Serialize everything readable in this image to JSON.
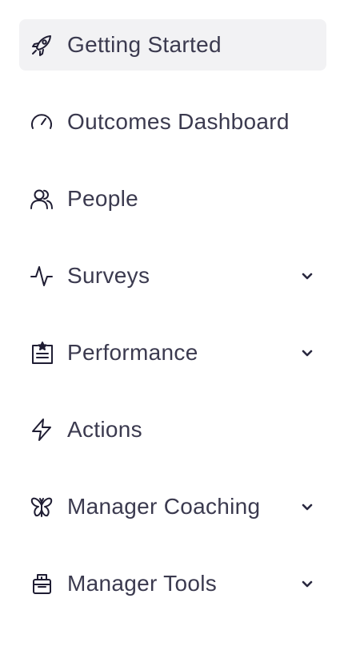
{
  "sidebar": {
    "items": [
      {
        "label": "Getting Started",
        "icon": "rocket-icon",
        "active": true,
        "expandable": false
      },
      {
        "label": "Outcomes Dashboard",
        "icon": "gauge-icon",
        "active": false,
        "expandable": false
      },
      {
        "label": "People",
        "icon": "people-icon",
        "active": false,
        "expandable": false
      },
      {
        "label": "Surveys",
        "icon": "pulse-icon",
        "active": false,
        "expandable": true
      },
      {
        "label": "Performance",
        "icon": "clipboard-star-icon",
        "active": false,
        "expandable": true
      },
      {
        "label": "Actions",
        "icon": "lightning-icon",
        "active": false,
        "expandable": false
      },
      {
        "label": "Manager Coaching",
        "icon": "butterfly-icon",
        "active": false,
        "expandable": true
      },
      {
        "label": "Manager Tools",
        "icon": "toolbox-icon",
        "active": false,
        "expandable": true
      }
    ]
  },
  "colors": {
    "text": "#3b3a4f",
    "icon": "#1f1d33",
    "active_background": "#f2f2f4"
  }
}
